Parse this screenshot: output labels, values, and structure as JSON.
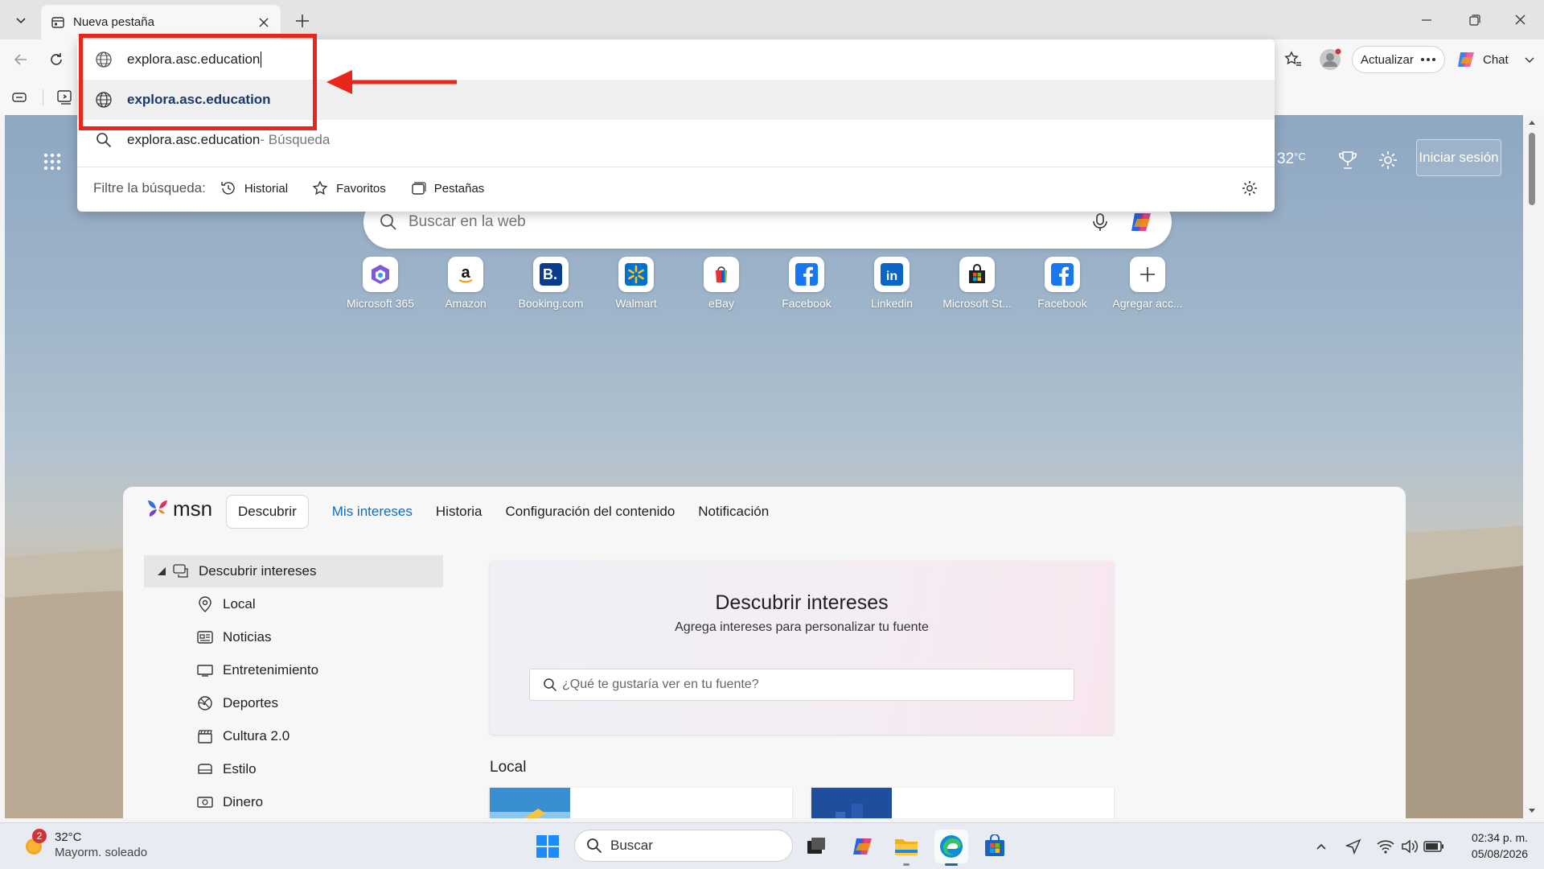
{
  "browser": {
    "tab": {
      "title": "Nueva pestaña"
    },
    "address": {
      "typed_text": "explora.asc.education"
    },
    "toolbar": {
      "update_label": "Actualizar",
      "chat_label": "Chat"
    }
  },
  "omnibox": {
    "suggestion_url": "explora.asc.education",
    "search_query": "explora.asc.education",
    "search_suffix": " - Búsqueda",
    "filter_label": "Filtre la búsqueda:",
    "filters": [
      {
        "label": "Historial",
        "icon": "history-icon"
      },
      {
        "label": "Favoritos",
        "icon": "star-icon"
      },
      {
        "label": "Pestañas",
        "icon": "tabs-icon"
      }
    ]
  },
  "newtab": {
    "weather_temp": "32",
    "weather_unit": "°C",
    "signin_label": "Iniciar sesión",
    "search_placeholder": "Buscar en la web",
    "quick_links": [
      {
        "label": "Microsoft 365",
        "icon": "microsoft365-icon"
      },
      {
        "label": "Amazon",
        "icon": "amazon-icon"
      },
      {
        "label": "Booking.com",
        "icon": "booking-icon"
      },
      {
        "label": "Walmart",
        "icon": "walmart-icon"
      },
      {
        "label": "eBay",
        "icon": "ebay-icon"
      },
      {
        "label": "Facebook",
        "icon": "facebook-icon"
      },
      {
        "label": "Linkedin",
        "icon": "linkedin-icon"
      },
      {
        "label": "Microsoft St...",
        "icon": "microsoft-store-icon"
      },
      {
        "label": "Facebook",
        "icon": "facebook-icon"
      },
      {
        "label": "Agregar acc...",
        "icon": "plus-icon"
      }
    ]
  },
  "msn": {
    "logo_text": "msn",
    "tabs": [
      "Descubrir",
      "Mis intereses",
      "Historia",
      "Configuración del contenido",
      "Notificación"
    ],
    "active_tab": "Mis intereses",
    "tree_head": "Descubrir intereses",
    "tree_items": [
      {
        "label": "Local",
        "icon": "location-icon"
      },
      {
        "label": "Noticias",
        "icon": "news-icon"
      },
      {
        "label": "Entretenimiento",
        "icon": "tv-icon"
      },
      {
        "label": "Deportes",
        "icon": "sports-icon"
      },
      {
        "label": "Cultura 2.0",
        "icon": "clapper-icon"
      },
      {
        "label": "Estilo",
        "icon": "style-icon"
      },
      {
        "label": "Dinero",
        "icon": "money-icon"
      }
    ],
    "discover": {
      "title": "Descubrir intereses",
      "subtitle": "Agrega intereses para personalizar tu fuente",
      "input_placeholder": "¿Qué te gustaría ver en tu fuente?"
    },
    "local_heading": "Local"
  },
  "taskbar": {
    "weather_temp": "32°C",
    "weather_desc": "Mayorm. soleado",
    "weather_badge": "2",
    "search_label": "Buscar",
    "time": "02:34 p. m.",
    "date": "05/08/2026"
  },
  "colors": {
    "annotation_red": "#e8261b",
    "link_blue": "#0f6cbd",
    "suggestion_text": "#1b3a6b"
  }
}
